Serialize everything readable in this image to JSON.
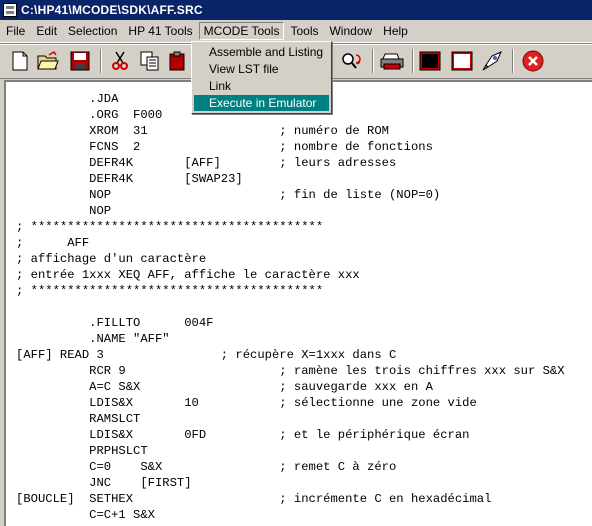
{
  "window": {
    "title": "C:\\HP41\\MCODE\\SDK\\AFF.SRC"
  },
  "menu": {
    "items": [
      "File",
      "Edit",
      "Selection",
      "HP 41 Tools",
      "MCODE Tools",
      "Tools",
      "Window",
      "Help"
    ],
    "open_menu": "MCODE Tools"
  },
  "dropdown": {
    "items": [
      "Assemble and Listing",
      "View LST file",
      "Link",
      "Execute in Emulator"
    ],
    "highlighted": "Execute in Emulator"
  },
  "toolbar": {
    "icons": [
      "new-file-icon",
      "open-folder-icon",
      "save-icon",
      "cut-icon",
      "copy-icon",
      "paste-icon",
      "find-replace-icon",
      "print-icon",
      "black-screen-icon",
      "white-screen-icon",
      "rocket-icon",
      "stop-icon"
    ]
  },
  "colors": {
    "titlebar": "#0a246a",
    "menu_highlight": "#008080",
    "stop": "#e02020"
  },
  "code": [
    "          .JDA",
    "          .ORG  F000",
    "          XROM  31                  ; numéro de ROM",
    "          FCNS  2                   ; nombre de fonctions",
    "          DEFR4K       [AFF]        ; leurs adresses",
    "          DEFR4K       [SWAP23]",
    "          NOP                       ; fin de liste (NOP=0)",
    "          NOP",
    "; ****************************************",
    ";      AFF",
    "; affichage d'un caractère",
    "; entrée 1xxx XEQ AFF, affiche le caractère xxx",
    "; ****************************************",
    "",
    "          .FILLTO      004F",
    "          .NAME \"AFF\"",
    "[AFF] READ 3                ; récupère X=1xxx dans C",
    "          RCR 9                     ; ramène les trois chiffres xxx sur S&X",
    "          A=C S&X                   ; sauvegarde xxx en A",
    "          LDIS&X       10           ; sélectionne une zone vide",
    "          RAMSLCT",
    "          LDIS&X       0FD          ; et le périphérique écran",
    "          PRPHSLCT",
    "          C=0    S&X                ; remet C à zéro",
    "          JNC    [FIRST]",
    "[BOUCLE]  SETHEX                    ; incrémente C en hexadécimal",
    "          C=C+1 S&X"
  ]
}
